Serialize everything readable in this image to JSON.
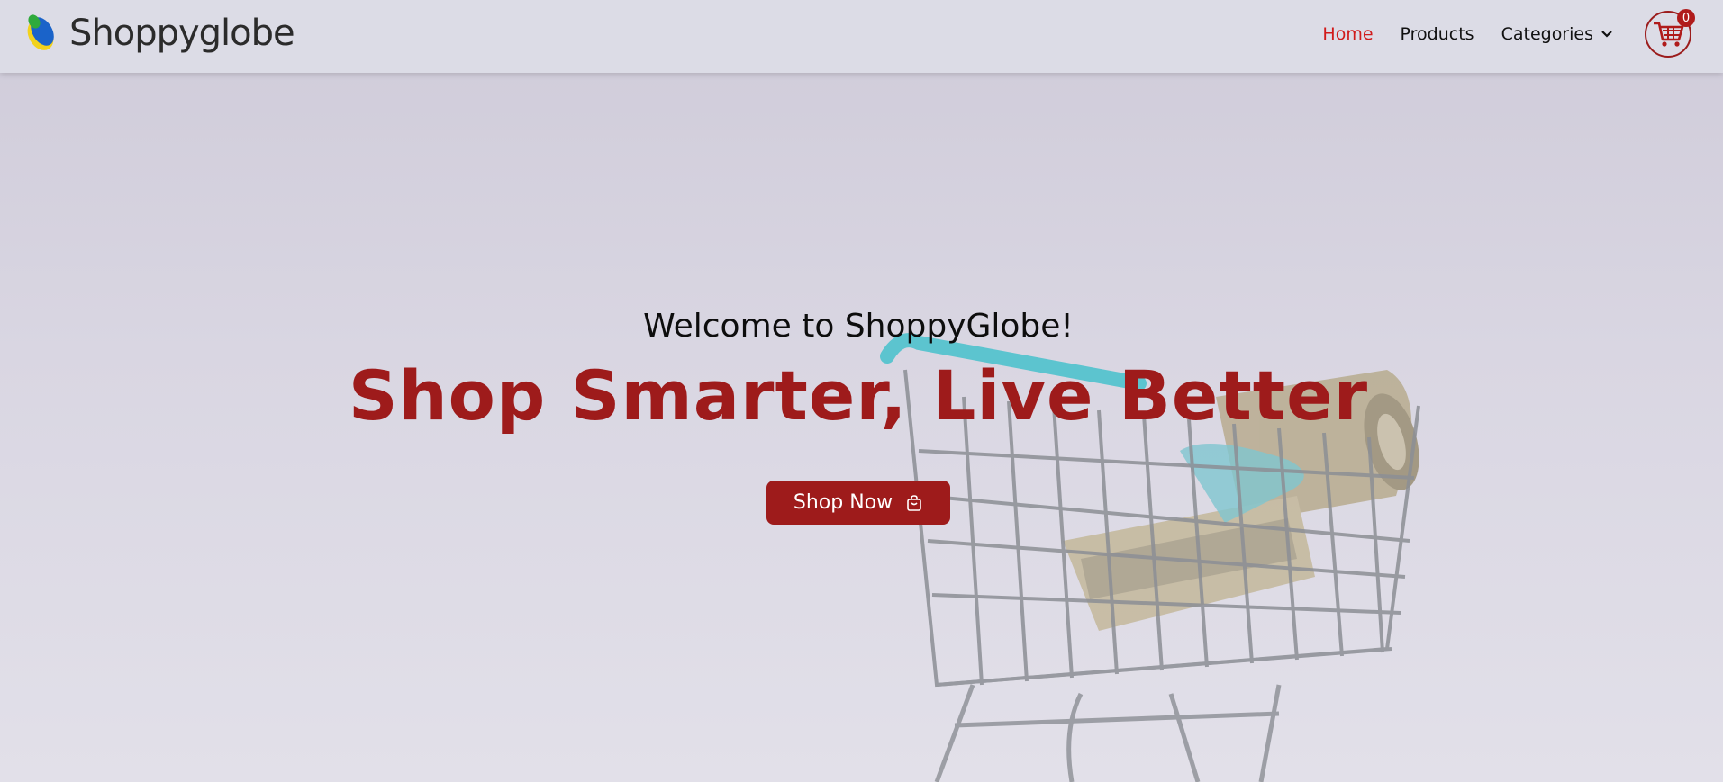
{
  "brand": {
    "name": "Shoppyglobe",
    "logo_icon": "globe-leaf-logo"
  },
  "nav": {
    "items": [
      {
        "label": "Home",
        "active": true
      },
      {
        "label": "Products",
        "active": false
      },
      {
        "label": "Categories",
        "active": false,
        "icon": "chevron-down-icon"
      }
    ]
  },
  "cart": {
    "count": "0",
    "icon": "cart-icon"
  },
  "hero": {
    "welcome": "Welcome to ShoppyGlobe!",
    "headline": "Shop Smarter, Live Better",
    "cta_label": "Shop Now",
    "cta_icon": "shopping-bag-icon"
  },
  "colors": {
    "accent": "#9e1b1b",
    "nav_active": "#d11b1b",
    "navbar_bg": "#dcdce6",
    "cart_teal": "#5cc4cf"
  }
}
